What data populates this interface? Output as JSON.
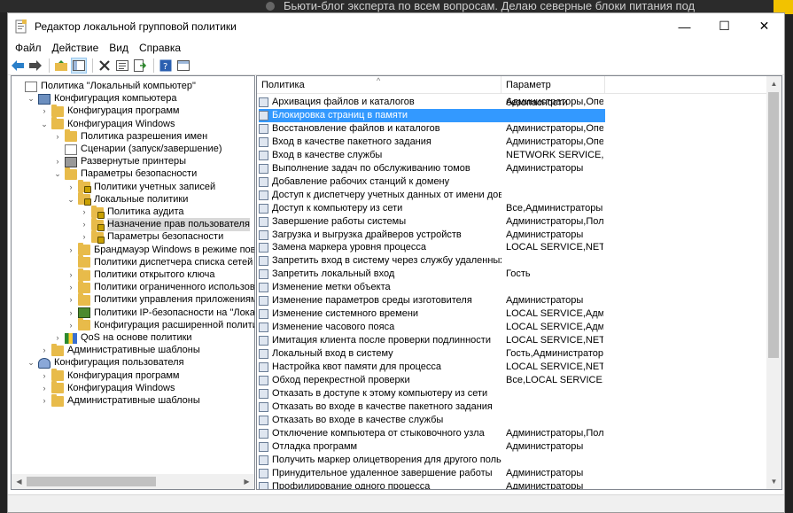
{
  "background": {
    "text": "Бьюти-блог эксперта по всем вопросам. Делаю северные блоки питания под"
  },
  "window": {
    "title": "Редактор локальной групповой политики",
    "buttons": {
      "minimize": "—",
      "maximize": "☐",
      "close": "✕"
    }
  },
  "menu": [
    "Файл",
    "Действие",
    "Вид",
    "Справка"
  ],
  "tree": [
    {
      "label": "Политика \"Локальный компьютер\"",
      "level": 0,
      "exp": "",
      "icon": "doc"
    },
    {
      "label": "Конфигурация компьютера",
      "level": 1,
      "exp": "v",
      "icon": "comp"
    },
    {
      "label": "Конфигурация программ",
      "level": 2,
      "exp": ">",
      "icon": "folder"
    },
    {
      "label": "Конфигурация Windows",
      "level": 2,
      "exp": "v",
      "icon": "folder"
    },
    {
      "label": "Политика разрешения имен",
      "level": 3,
      "exp": ">",
      "icon": "folder"
    },
    {
      "label": "Сценарии (запуск/завершение)",
      "level": 3,
      "exp": "",
      "icon": "doc"
    },
    {
      "label": "Развернутые принтеры",
      "level": 3,
      "exp": ">",
      "icon": "printer"
    },
    {
      "label": "Параметры безопасности",
      "level": 3,
      "exp": "v",
      "icon": "folder"
    },
    {
      "label": "Политики учетных записей",
      "level": 4,
      "exp": ">",
      "icon": "folder lock"
    },
    {
      "label": "Локальные политики",
      "level": 4,
      "exp": "v",
      "icon": "folder lock"
    },
    {
      "label": "Политика аудита",
      "level": 5,
      "exp": ">",
      "icon": "folder lock"
    },
    {
      "label": "Назначение прав пользователя",
      "level": 5,
      "exp": ">",
      "icon": "folder lock",
      "selected": true
    },
    {
      "label": "Параметры безопасности",
      "level": 5,
      "exp": ">",
      "icon": "folder lock"
    },
    {
      "label": "Брандмауэр Windows в режиме повышенно",
      "level": 4,
      "exp": ">",
      "icon": "folder"
    },
    {
      "label": "Политики диспетчера списка сетей",
      "level": 4,
      "exp": "",
      "icon": "folder"
    },
    {
      "label": "Политики открытого ключа",
      "level": 4,
      "exp": ">",
      "icon": "folder"
    },
    {
      "label": "Политики ограниченного использования пр",
      "level": 4,
      "exp": ">",
      "icon": "folder"
    },
    {
      "label": "Политики управления приложениями",
      "level": 4,
      "exp": ">",
      "icon": "folder"
    },
    {
      "label": "Политики IP-безопасности на \"Локальный к",
      "level": 4,
      "exp": ">",
      "icon": "shield"
    },
    {
      "label": "Конфигурация расширенной политики ауди",
      "level": 4,
      "exp": ">",
      "icon": "folder"
    },
    {
      "label": "QoS на основе политики",
      "level": 3,
      "exp": ">",
      "icon": "chart"
    },
    {
      "label": "Административные шаблоны",
      "level": 2,
      "exp": ">",
      "icon": "folder"
    },
    {
      "label": "Конфигурация пользователя",
      "level": 1,
      "exp": "v",
      "icon": "user"
    },
    {
      "label": "Конфигурация программ",
      "level": 2,
      "exp": ">",
      "icon": "folder"
    },
    {
      "label": "Конфигурация Windows",
      "level": 2,
      "exp": ">",
      "icon": "folder"
    },
    {
      "label": "Административные шаблоны",
      "level": 2,
      "exp": ">",
      "icon": "folder"
    }
  ],
  "list": {
    "columns": [
      "Политика",
      "Параметр безопасности"
    ],
    "rows": [
      {
        "policy": "Архивация файлов и каталогов",
        "setting": "Администраторы,Опер..."
      },
      {
        "policy": "Блокировка страниц в памяти",
        "setting": "",
        "selected": true
      },
      {
        "policy": "Восстановление файлов и каталогов",
        "setting": "Администраторы,Опер..."
      },
      {
        "policy": "Вход в качестве пакетного задания",
        "setting": "Администраторы,Опер..."
      },
      {
        "policy": "Вход в качестве службы",
        "setting": "NETWORK SERVICE,NT ..."
      },
      {
        "policy": "Выполнение задач по обслуживанию томов",
        "setting": "Администраторы"
      },
      {
        "policy": "Добавление рабочих станций к домену",
        "setting": ""
      },
      {
        "policy": "Доступ к диспетчеру учетных данных от имени доверенн...",
        "setting": ""
      },
      {
        "policy": "Доступ к компьютеру из сети",
        "setting": "Все,Администраторы,..."
      },
      {
        "policy": "Завершение работы системы",
        "setting": "Администраторы,Поль..."
      },
      {
        "policy": "Загрузка и выгрузка драйверов устройств",
        "setting": "Администраторы"
      },
      {
        "policy": "Замена маркера уровня процесса",
        "setting": "LOCAL SERVICE,NETWO..."
      },
      {
        "policy": "Запретить вход в систему через службу удаленных рабоч...",
        "setting": ""
      },
      {
        "policy": "Запретить локальный вход",
        "setting": "Гость"
      },
      {
        "policy": "Изменение метки объекта",
        "setting": ""
      },
      {
        "policy": "Изменение параметров среды изготовителя",
        "setting": "Администраторы"
      },
      {
        "policy": "Изменение системного времени",
        "setting": "LOCAL SERVICE,Админ..."
      },
      {
        "policy": "Изменение часового пояса",
        "setting": "LOCAL SERVICE,Админ..."
      },
      {
        "policy": "Имитация клиента после проверки подлинности",
        "setting": "LOCAL SERVICE,NETWO..."
      },
      {
        "policy": "Локальный вход в систему",
        "setting": "Гость,Администраторы,..."
      },
      {
        "policy": "Настройка квот памяти для процесса",
        "setting": "LOCAL SERVICE,NETWO..."
      },
      {
        "policy": "Обход перекрестной проверки",
        "setting": "Все,LOCAL SERVICE,NE..."
      },
      {
        "policy": "Отказать в доступе к этому компьютеру из сети",
        "setting": ""
      },
      {
        "policy": "Отказать во входе в качестве пакетного задания",
        "setting": ""
      },
      {
        "policy": "Отказать во входе в качестве службы",
        "setting": ""
      },
      {
        "policy": "Отключение компьютера от стыковочного узла",
        "setting": "Администраторы,Поль..."
      },
      {
        "policy": "Отладка программ",
        "setting": "Администраторы"
      },
      {
        "policy": "Получить маркер олицетворения для другого пользоват...",
        "setting": ""
      },
      {
        "policy": "Принудительное удаленное завершение работы",
        "setting": "Администраторы"
      },
      {
        "policy": "Профилирование одного процесса",
        "setting": "Администраторы"
      }
    ]
  }
}
